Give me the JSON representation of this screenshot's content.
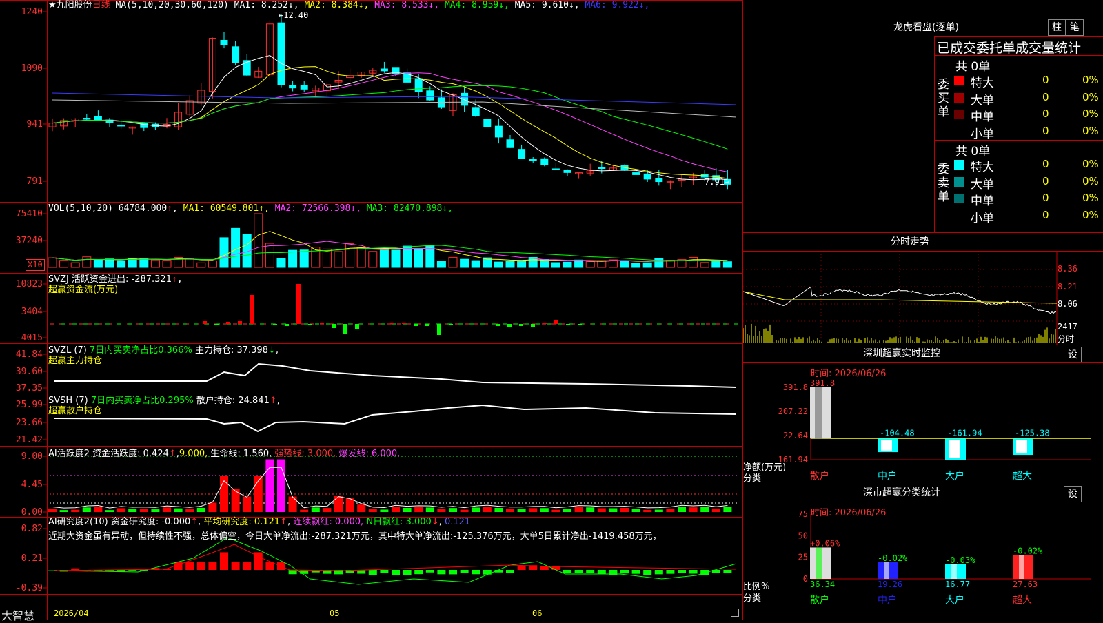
{
  "stock": {
    "name": "九阳股份",
    "star": "★",
    "period": "日线"
  },
  "axis_x": {
    "d1": "2026/04",
    "d2": "05",
    "d3": "06"
  },
  "logo": "大智慧",
  "kline": {
    "ma_label": "MA(5,10,20,30,60,120)",
    "ma": [
      {
        "label": "MA1:",
        "value": "8.252",
        "color": "#ffffff"
      },
      {
        "label": "MA2:",
        "value": "8.384",
        "color": "#ffff00"
      },
      {
        "label": "MA3:",
        "value": "8.533",
        "color": "#ff40ff"
      },
      {
        "label": "MA4:",
        "value": "8.959",
        "color": "#00ff00"
      },
      {
        "label": "MA5:",
        "value": "9.610",
        "color": "#ffffff"
      },
      {
        "label": "MA6:",
        "value": "9.922",
        "color": "#3a3aff"
      }
    ],
    "y_ticks": [
      "1240",
      "1090",
      "941",
      "791"
    ],
    "high_note": "12.40",
    "low_note": "7.91"
  },
  "vol": {
    "title": "VOL(5,10,20)",
    "value": "64784.000",
    "ma": [
      {
        "label": "MA1:",
        "value": "60549.801",
        "color": "#ffff00"
      },
      {
        "label": "MA2:",
        "value": "72566.398",
        "color": "#ff40ff"
      },
      {
        "label": "MA3:",
        "value": "82470.898",
        "color": "#00ff00"
      }
    ],
    "y_ticks": [
      "75410",
      "37240"
    ],
    "unit": "X10"
  },
  "svzj": {
    "title": "SVZJ  活跃资金进出: -287.321",
    "sub": "超赢资金流(万元)",
    "y_ticks": [
      "10823",
      "3404",
      "-4015"
    ]
  },
  "svzl": {
    "t1": "SVZL (7)",
    "t2": "7日内买卖净占比0.366%",
    "t3": "主力持仓: 37.398",
    "sub": "超赢主力持仓",
    "y_ticks": [
      "41.84",
      "39.60",
      "37.35"
    ]
  },
  "svsh": {
    "t1": "SVSH (7)",
    "t2": "7日内买卖净占比0.295%",
    "t3": "散户持仓: 24.841",
    "sub": "超赢散户持仓",
    "y_ticks": [
      "25.99",
      "23.66",
      "21.42"
    ]
  },
  "ai1": {
    "t1": "AI活跃度2 资金活跃度: 0.424",
    "t2": "9.000,",
    "t3": "生命线: 1.560,",
    "t4": "强势线: 3.000,",
    "t5": "爆发线: 6.000,",
    "y_ticks": [
      "9.00",
      "4.45",
      "0.00"
    ]
  },
  "ai2": {
    "t1": "AI研究度2(10) 资金研究度: -0.000",
    "t2": "平均研究度: 0.121",
    "t3": "连续飘红: 0.000,",
    "t4": "N日飘红: 3.000",
    "t5": "0.121",
    "comment": "近期大资金虽有异动，但持续性不强，总体偏空，今日大单净流出:-287.321万元，其中特大单净流出:-125.376万元，大单5日累计净出-1419.458万元，",
    "y_ticks": [
      "0.82",
      "0.21",
      "-0.39"
    ]
  },
  "lhb": {
    "title": "龙虎看盘(逐单)",
    "btn1": "柱",
    "btn2": "笔",
    "header": "已成交委托单成交量统计",
    "buy_label": "委买单",
    "sell_label": "委卖单",
    "buy_total": "共 0单",
    "sell_total": "共 0单",
    "buy_rows": [
      {
        "name": "特大",
        "count": "0",
        "pct": "0%",
        "color": "#ff0000"
      },
      {
        "name": "大单",
        "count": "0",
        "pct": "0%",
        "color": "#a00000"
      },
      {
        "name": "中单",
        "count": "0",
        "pct": "0%",
        "color": "#6a0000"
      },
      {
        "name": "小单",
        "count": "0",
        "pct": "0%",
        "color": ""
      }
    ],
    "sell_rows": [
      {
        "name": "特大",
        "count": "0",
        "pct": "0%",
        "color": "#00ffff"
      },
      {
        "name": "大单",
        "count": "0",
        "pct": "0%",
        "color": "#009090"
      },
      {
        "name": "中单",
        "count": "0",
        "pct": "0%",
        "color": "#007070"
      },
      {
        "name": "小单",
        "count": "0",
        "pct": "0%",
        "color": ""
      }
    ]
  },
  "intraday": {
    "title": "分时走势",
    "y_ticks": [
      "8.36",
      "8.21",
      "8.06"
    ],
    "vol_tick": "2417",
    "vol_label": "分时"
  },
  "sz_monitor": {
    "title": "深圳超赢实时监控",
    "btn": "设",
    "time": "时间: 2026/06/26",
    "y_ticks": [
      "391.8",
      "207.22",
      "22.64",
      "-161.94"
    ],
    "ylabel": "净额(万元)",
    "xlabel": "分类",
    "categories": [
      "散户",
      "中户",
      "大户",
      "超大"
    ],
    "values": [
      391.8,
      -104.48,
      -161.94,
      -125.38
    ],
    "value_labels": [
      "391.8",
      "-104.48",
      "-161.94",
      "-125.38"
    ]
  },
  "sz_class": {
    "title": "深市超赢分类统计",
    "btn": "设",
    "time": "时间: 2026/06/26",
    "y_ticks": [
      "75",
      "50",
      "25",
      "0"
    ],
    "ylabel": "比例%",
    "xlabel": "分类",
    "categories": [
      "散户",
      "中户",
      "大户",
      "超大"
    ],
    "values": [
      36.34,
      19.26,
      16.77,
      27.63
    ],
    "changes": [
      "+0.06%",
      "-0.02%",
      "-0.03%",
      "-0.02%"
    ]
  },
  "chart_data": [
    {
      "type": "bar",
      "title": "深圳超赢实时监控",
      "ylabel": "净额(万元)",
      "xlabel": "分类",
      "categories": [
        "散户",
        "中户",
        "大户",
        "超大"
      ],
      "values": [
        391.8,
        -104.48,
        -161.94,
        -125.38
      ],
      "ylim": [
        -161.94,
        391.8
      ]
    },
    {
      "type": "bar",
      "title": "深市超赢分类统计",
      "ylabel": "比例%",
      "xlabel": "分类",
      "categories": [
        "散户",
        "中户",
        "大户",
        "超大"
      ],
      "values": [
        36.34,
        19.26,
        16.77,
        27.63
      ],
      "ylim": [
        0,
        75
      ]
    },
    {
      "type": "line",
      "title": "九阳股份 日线",
      "series": [
        {
          "name": "MA1",
          "values": [
            8.252
          ]
        },
        {
          "name": "MA2",
          "values": [
            8.384
          ]
        },
        {
          "name": "MA3",
          "values": [
            8.533
          ]
        },
        {
          "name": "MA4",
          "values": [
            8.959
          ]
        },
        {
          "name": "MA5",
          "values": [
            9.61
          ]
        },
        {
          "name": "MA6",
          "values": [
            9.922
          ]
        }
      ]
    }
  ]
}
